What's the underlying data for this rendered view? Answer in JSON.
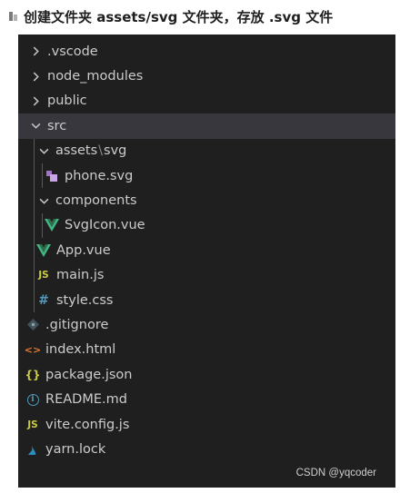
{
  "heading": "创建文件夹 assets/svg 文件夹，存放 .svg 文件",
  "colors": {
    "panel_bg": "#1f1f1f",
    "selected_row": "#37373d",
    "text": "#cccccc",
    "vue_green": "#41b883",
    "js_yellow": "#cbcb41",
    "css_blue": "#519aba",
    "html_orange": "#e37933"
  },
  "explorer": {
    "vscode": ".vscode",
    "node_modules": "node_modules",
    "public": "public",
    "src": "src",
    "assets": "assets",
    "svg": "svg",
    "assets_sep": "\\",
    "phone_svg": "phone.svg",
    "components": "components",
    "svgicon_vue": "SvgIcon.vue",
    "app_vue": "App.vue",
    "main_js": "main.js",
    "style_css": "style.css",
    "gitignore": ".gitignore",
    "index_html": "index.html",
    "package_json": "package.json",
    "readme_md": "README.md",
    "vite_config_js": "vite.config.js",
    "yarn_lock": "yarn.lock"
  },
  "icons": {
    "js_glyph": "JS",
    "css_glyph": "#",
    "json_glyph": "{}",
    "html_glyph": "<>",
    "info_glyph": "i"
  },
  "watermark": "CSDN @yqcoder"
}
